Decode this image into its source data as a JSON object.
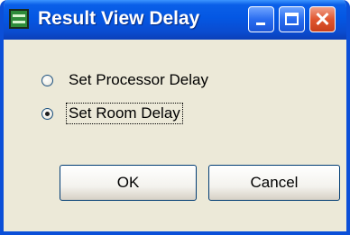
{
  "window": {
    "title": "Result View Delay",
    "app_icon": "app-window-icon",
    "controls": {
      "minimize_icon": "minimize-icon",
      "maximize_icon": "maximize-icon",
      "close_icon": "close-icon",
      "close_glyph": "✕"
    }
  },
  "options": [
    {
      "label": "Set Processor Delay",
      "checked": false
    },
    {
      "label": "Set Room Delay",
      "checked": true
    }
  ],
  "buttons": {
    "ok_label": "OK",
    "cancel_label": "Cancel"
  },
  "colors": {
    "titlebar": "#0457e3",
    "frame": "#0b4fd8",
    "dialog_bg": "#ece9d8",
    "close_button": "#e0562f"
  }
}
